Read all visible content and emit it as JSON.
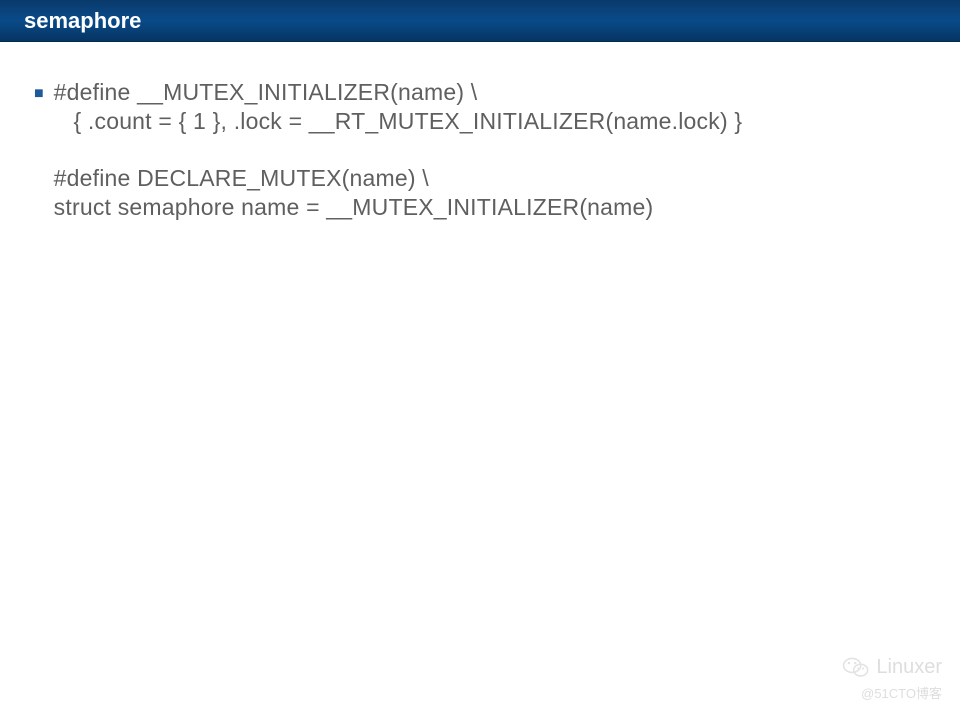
{
  "header": {
    "title": "semaphore"
  },
  "content": {
    "code": "#define __MUTEX_INITIALIZER(name) \\\n   { .count = { 1 }, .lock = __RT_MUTEX_INITIALIZER(name.lock) }\n\n#define DECLARE_MUTEX(name) \\\nstruct semaphore name = __MUTEX_INITIALIZER(name)"
  },
  "watermark": {
    "brand": "Linuxer",
    "sub": "@51CTO博客"
  }
}
